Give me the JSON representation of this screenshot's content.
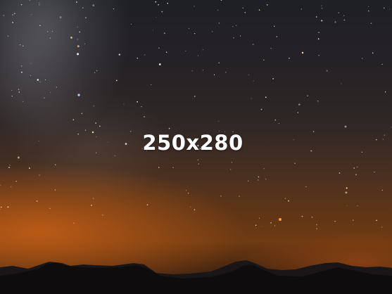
{
  "placeholder": {
    "dimension_text": "250x280"
  },
  "photo": {
    "subject": "night-sky-with-stars-over-mountain-silhouette",
    "colors": {
      "sky_top": "#1f2024",
      "sky_glow": "#6e3a12",
      "horizon_glow": "#be5c16",
      "mountains": "#120f10"
    }
  }
}
